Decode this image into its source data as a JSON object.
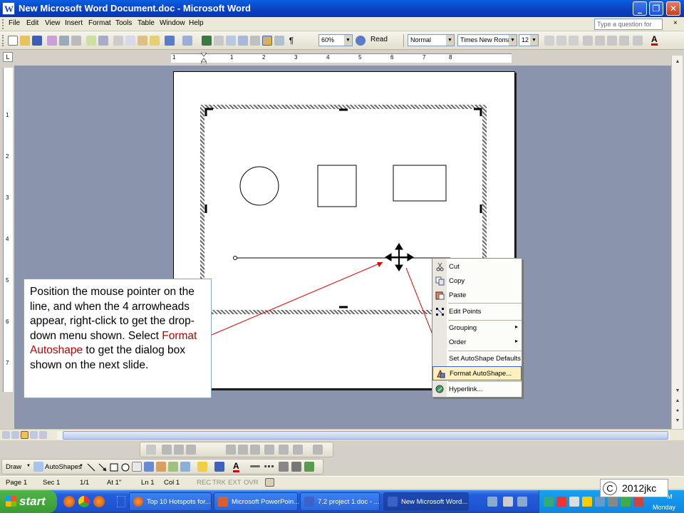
{
  "window": {
    "title": "New Microsoft Word Document.doc - Microsoft Word",
    "app_icon": "W",
    "minimize_label": "_",
    "restore_label": "❐",
    "close_label": "✕"
  },
  "menu": {
    "items": [
      "File",
      "Edit",
      "View",
      "Insert",
      "Format",
      "Tools",
      "Table",
      "Window",
      "Help"
    ],
    "help_placeholder": "Type a question for help",
    "close_doc_label": "×"
  },
  "toolbar": {
    "zoom": "60%",
    "read_label": "Read",
    "style": "Normal",
    "font": "Times New Roman",
    "size": "12",
    "font_color_label": "A"
  },
  "ruler": {
    "corner_label": "L",
    "h_numbers": [
      "1",
      "1",
      "2",
      "3",
      "4",
      "5",
      "6",
      "7",
      "8"
    ],
    "v_numbers": [
      "1",
      "2",
      "3",
      "4",
      "5",
      "6",
      "7"
    ]
  },
  "callout": {
    "text_before": "Position the mouse pointer on the line, and when the 4 arrowheads appear, right-click to get the drop-down menu shown. Select ",
    "highlight": "Format Autoshape",
    "text_after": " to get the dialog box shown on the next slide."
  },
  "context_menu": {
    "items": [
      {
        "label": "Cut",
        "icon": "scissors-icon"
      },
      {
        "label": "Copy",
        "icon": "copy-icon"
      },
      {
        "label": "Paste",
        "icon": "paste-icon"
      },
      {
        "label": "Edit Points",
        "icon": "edit-points-icon"
      },
      {
        "label": "Grouping",
        "submenu": "▸"
      },
      {
        "label": "Order",
        "submenu": "▸"
      },
      {
        "label": "Set AutoShape Defaults"
      },
      {
        "label": "Format AutoShape...",
        "icon": "format-autoshape-icon",
        "highlighted": true
      },
      {
        "label": "Hyperlink...",
        "icon": "hyperlink-icon"
      }
    ]
  },
  "drawing_toolbar": {
    "draw_label": "Draw",
    "autoshapes_label": "AutoShapes"
  },
  "status": {
    "page": "Page 1",
    "sec": "Sec 1",
    "pages": "1/1",
    "at": "At 1\"",
    "ln": "Ln 1",
    "col": "Col 1",
    "rec": "REC",
    "trk": "TRK",
    "ext": "EXT",
    "ovr": "OVR"
  },
  "taskbar": {
    "start_label": "start",
    "tasks": [
      {
        "label": "Top 10 Hotspots for...",
        "icon": "firefox-icon"
      },
      {
        "label": "Microsoft PowerPoin...",
        "icon": "powerpoint-icon"
      },
      {
        "label": "7.2 project 1.doc - ...",
        "icon": "word-icon"
      },
      {
        "label": "New Microsoft Word...",
        "icon": "word-icon",
        "active": true
      }
    ],
    "clock_suffix": "M",
    "day": "Monday"
  },
  "watermark": {
    "symbol": "C",
    "text": "2012jkc"
  },
  "colors": {
    "title_bar": "#0a4fd0",
    "callout_highlight": "#c00000",
    "pointer_arrow": "#e00000",
    "workspace": "#8a94ad"
  }
}
